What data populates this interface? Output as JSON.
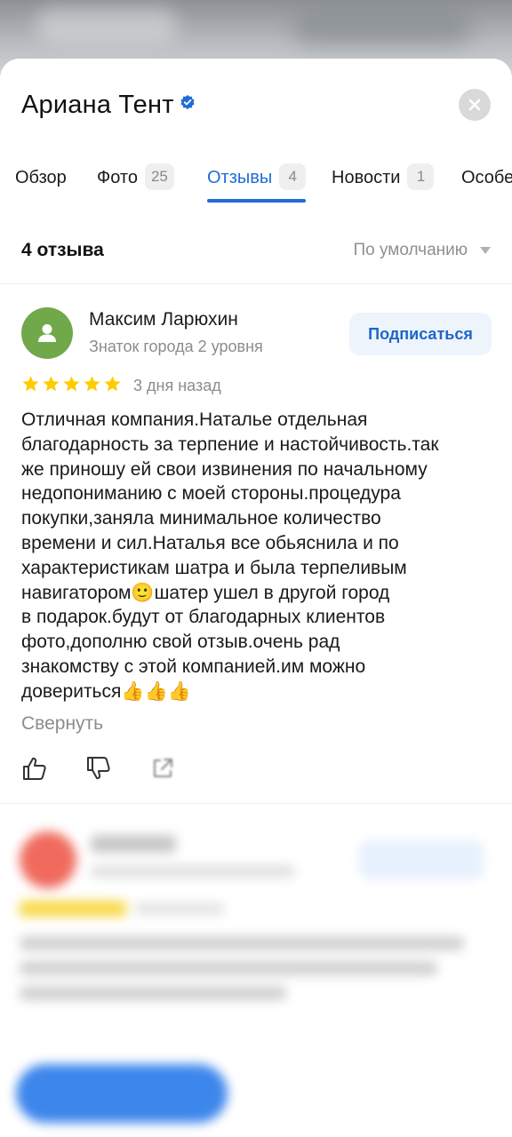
{
  "place": {
    "title": "Ариана Тент",
    "verified_icon": "verified-check-icon",
    "close_icon": "close-icon"
  },
  "tabs": [
    {
      "label": "Обзор",
      "count": ""
    },
    {
      "label": "Фото",
      "count": "25"
    },
    {
      "label": "Отзывы",
      "count": "4",
      "active": true
    },
    {
      "label": "Новости",
      "count": "1"
    },
    {
      "label": "Особенности",
      "count": ""
    }
  ],
  "reviews_header": {
    "count_label": "4 отзыва",
    "sort_label": "По умолчанию"
  },
  "review": {
    "author": "Максим Ларюхин",
    "level": "Знаток города 2 уровня",
    "subscribe_label": "Подписаться",
    "rating": 5,
    "date": "3 дня назад",
    "text": "Отличная компания.Наталье отдельная\nблагодарность за терпение и настойчивость.так\nже приношу ей свои извинения по начальному\nнедопониманию с моей стороны.процедура\nпокупки,заняла минимальное количество\nвремени и сил.Наталья  все обьяснила  и по\nхарактеристикам шатра и была терпеливым\nнавигатором🙂шатер ушел в другой город\nв подарок.будут от благодарных клиентов\nфото,дополню свой отзыв.очень рад\nзнакомству с этой компанией.им можно\nдовериться👍👍👍",
    "collapse_label": "Свернуть"
  },
  "colors": {
    "accent": "#1f6cd6",
    "avatar": "#71a84a",
    "star": "#ffcc00"
  }
}
